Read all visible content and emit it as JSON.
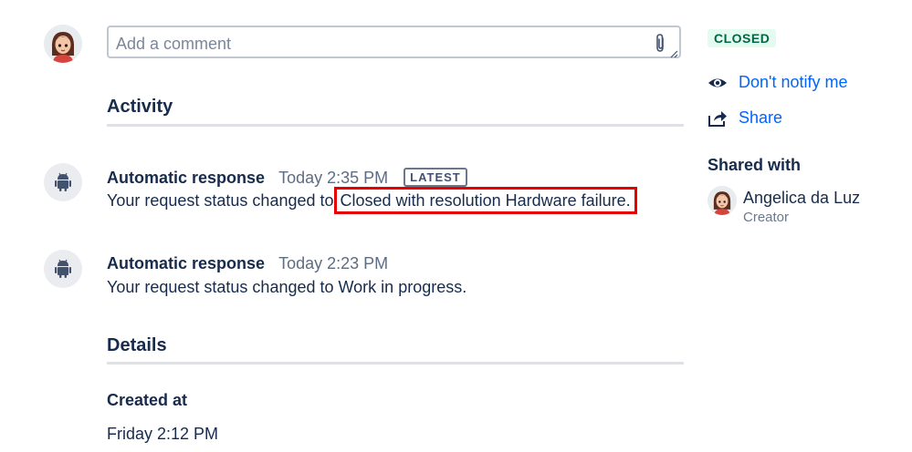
{
  "comment": {
    "placeholder": "Add a comment"
  },
  "activity": {
    "heading": "Activity",
    "entries": [
      {
        "author": "Automatic response",
        "time": "Today 2:35 PM",
        "badge": "LATEST",
        "text_prefix": "Your request status changed to ",
        "text_highlight": "Closed with resolution Hardware failure."
      },
      {
        "author": "Automatic response",
        "time": "Today 2:23 PM",
        "text": "Your request status changed to Work in progress."
      }
    ]
  },
  "details": {
    "heading": "Details",
    "created_label": "Created at",
    "created_value": "Friday 2:12 PM"
  },
  "sidebar": {
    "status": "CLOSED",
    "status_color": "#006644",
    "status_bg": "#e3fcef",
    "notify_label": "Don't notify me",
    "notify_icon": "eye-icon",
    "share_label": "Share",
    "share_icon": "share-icon",
    "shared_heading": "Shared with",
    "shared_user": {
      "name": "Angelica da Luz",
      "role": "Creator"
    }
  },
  "colors": {
    "link": "#0065ff",
    "highlight_border": "#e60000"
  }
}
